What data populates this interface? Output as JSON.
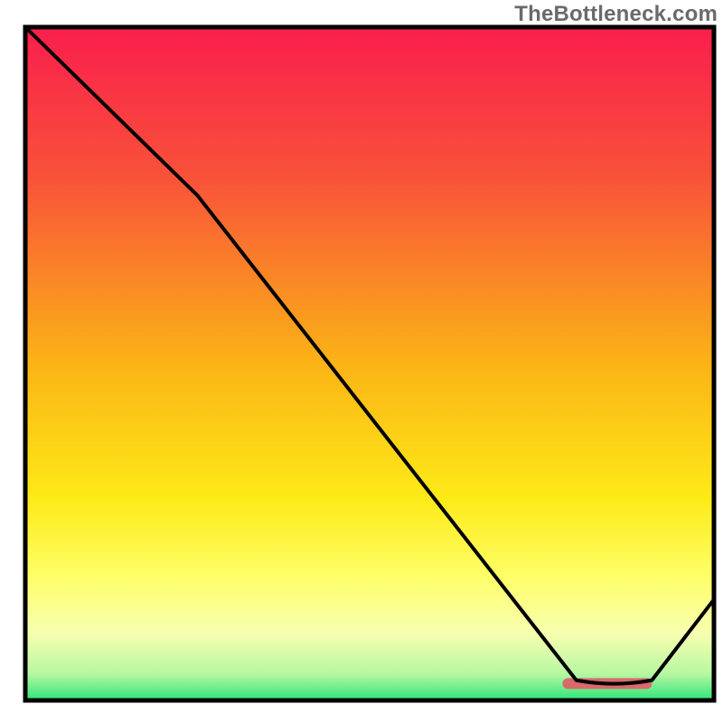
{
  "watermark": "TheBottleneck.com",
  "chart_data": {
    "type": "line",
    "title": "",
    "xlabel": "",
    "ylabel": "",
    "xlim": [
      0,
      100
    ],
    "ylim": [
      0,
      100
    ],
    "grid": false,
    "series": [
      {
        "name": "bottleneck-curve",
        "x": [
          0,
          25,
          80,
          91,
          100
        ],
        "values": [
          100,
          75,
          3,
          3,
          15
        ]
      }
    ],
    "annotations": [
      {
        "name": "sweet-spot-bar",
        "type": "bar_segment",
        "x_start": 78,
        "x_end": 91,
        "y": 2.5,
        "color": "#d86a6a"
      }
    ],
    "background_gradient": {
      "stops": [
        {
          "offset": 0.0,
          "color": "#f91e4c"
        },
        {
          "offset": 0.22,
          "color": "#f9513a"
        },
        {
          "offset": 0.5,
          "color": "#fbb316"
        },
        {
          "offset": 0.7,
          "color": "#fdea17"
        },
        {
          "offset": 0.82,
          "color": "#feff6b"
        },
        {
          "offset": 0.9,
          "color": "#f7ffb0"
        },
        {
          "offset": 0.96,
          "color": "#b9f7a2"
        },
        {
          "offset": 1.0,
          "color": "#2ee57a"
        }
      ]
    },
    "axis_color": "#000000",
    "curve_color": "#000000"
  }
}
